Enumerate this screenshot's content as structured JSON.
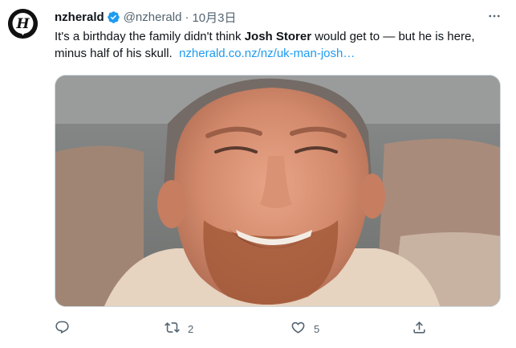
{
  "tweet": {
    "display_name": "nzherald",
    "handle": "@nzherald",
    "separator": "·",
    "date": "10月3日",
    "text_part1": "It's a birthday the family didn't think ",
    "text_bold": "Josh Storer",
    "text_part2": " would get to — but he is here, minus half of his skull.",
    "link_text": "nzherald.co.nz/nz/uk-man-josh…",
    "avatar_letter": "H",
    "more_icon": "more-horizontal-icon"
  },
  "actions": {
    "reply_count": "",
    "retweet_count": "2",
    "like_count": "5",
    "share_count": ""
  },
  "colors": {
    "link": "#1d9bf0",
    "verified": "#1d9bf0",
    "secondary_text": "#536471",
    "primary_text": "#0f1419"
  },
  "icons": [
    "verified-badge-icon",
    "reply-icon",
    "retweet-icon",
    "like-icon",
    "share-icon"
  ]
}
